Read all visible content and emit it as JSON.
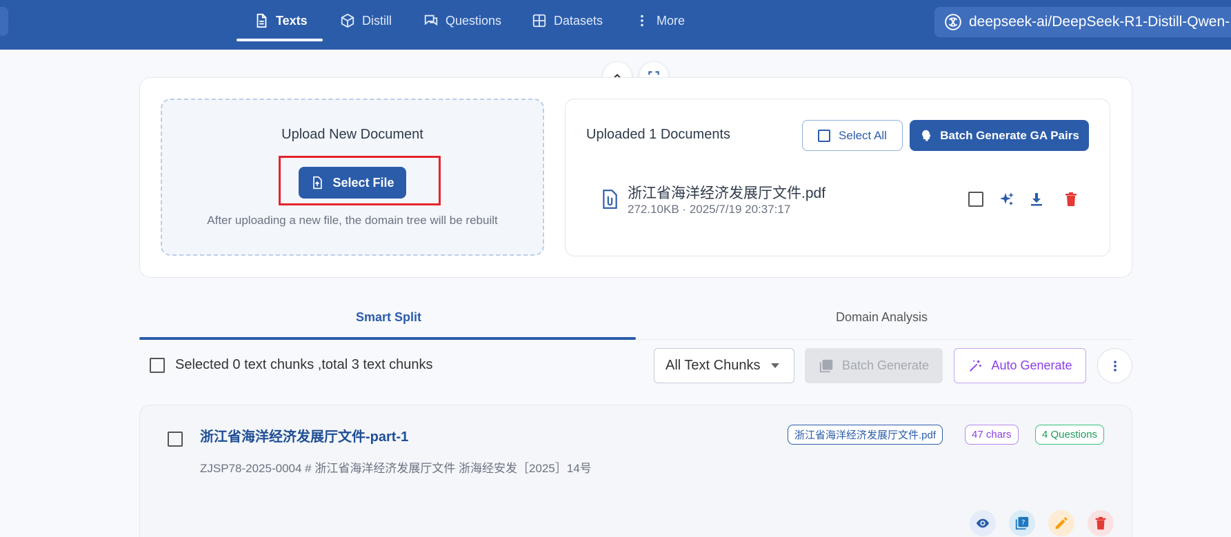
{
  "nav": {
    "tabs": [
      {
        "label": "Texts",
        "icon": "document-icon",
        "active": true
      },
      {
        "label": "Distill",
        "icon": "cube-icon",
        "active": false
      },
      {
        "label": "Questions",
        "icon": "chat-icon",
        "active": false
      },
      {
        "label": "Datasets",
        "icon": "grid-icon",
        "active": false
      },
      {
        "label": "More",
        "icon": "kebab-icon",
        "active": false
      }
    ],
    "model": "deepseek-ai/DeepSeek-R1-Distill-Qwen-"
  },
  "upload": {
    "title": "Upload New Document",
    "button_label": "Select File",
    "hint": "After uploading a new file, the domain tree will be rebuilt"
  },
  "documents": {
    "title": "Uploaded 1 Documents",
    "select_all_label": "Select All",
    "batch_label": "Batch Generate GA Pairs",
    "files": [
      {
        "name": "浙江省海洋经济发展厅文件.pdf",
        "meta": "272.10KB · 2025/7/19 20:37:17"
      }
    ]
  },
  "tabs": {
    "smart_split": "Smart Split",
    "domain_analysis": "Domain Analysis"
  },
  "toolbar": {
    "selection_text": "Selected 0 text chunks ,total 3 text chunks",
    "filter_value": "All Text Chunks",
    "batch_generate_label": "Batch Generate",
    "auto_generate_label": "Auto Generate"
  },
  "chunks": [
    {
      "title": "浙江省海洋经济发展厅文件-part-1",
      "body": "ZJSP78-2025-0004 # 浙江省海洋经济发展厅文件 浙海经安发［2025］14号",
      "file_chip": "浙江省海洋经济发展厅文件.pdf",
      "chars_chip": "47 chars",
      "questions_chip": "4 Questions"
    }
  ],
  "colors": {
    "primary": "#2b5caa",
    "danger": "#e53935",
    "purple": "#8b3fe6",
    "green": "#1a9c5a",
    "orange": "#f59e0b",
    "highlight": "#e6232a"
  }
}
